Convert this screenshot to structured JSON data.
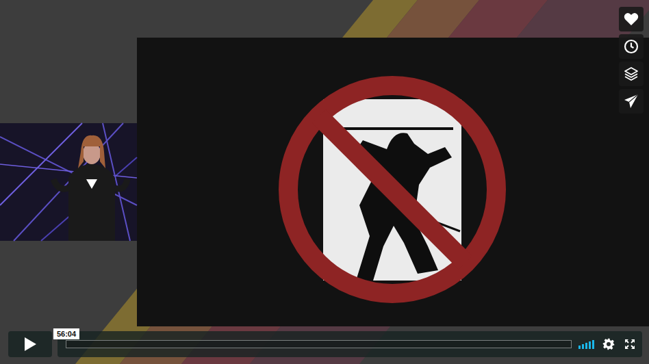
{
  "player": {
    "playing": false,
    "time_tooltip": "56:04",
    "progress": {
      "level": 0
    },
    "volume": {
      "level": 1
    }
  }
}
